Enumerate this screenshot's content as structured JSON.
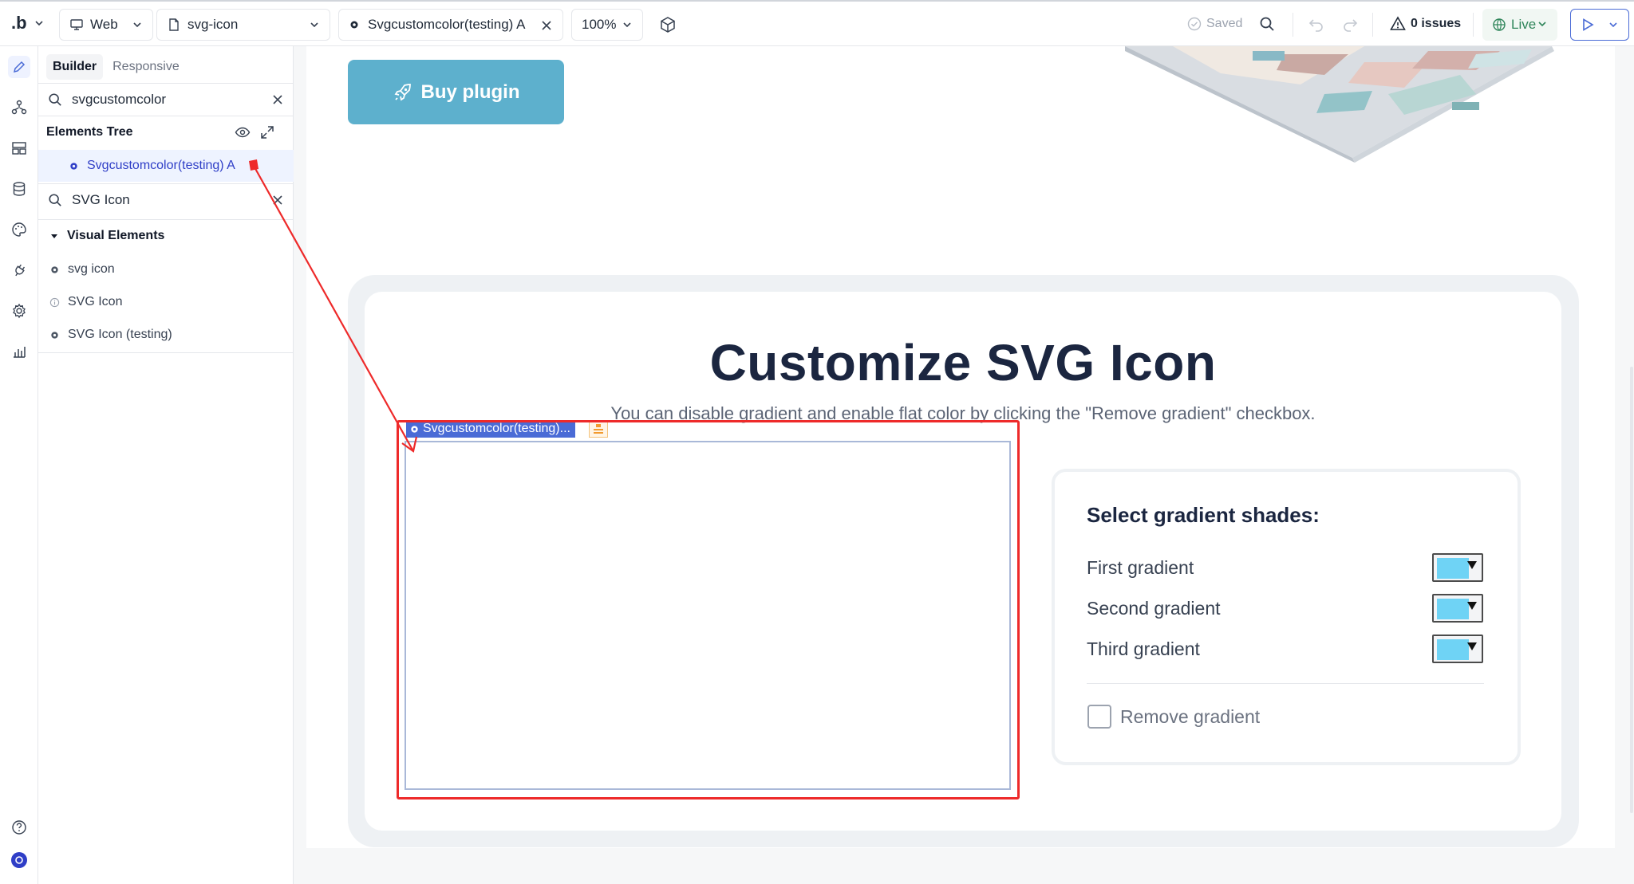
{
  "topbar": {
    "logo": ".b",
    "platform": "Web",
    "page": "svg-icon",
    "element_tab": "Svgcustomcolor(testing) A",
    "zoom": "100%",
    "saved": "Saved",
    "issues": "0 issues",
    "live": "Live"
  },
  "panel": {
    "tabs": [
      "Builder",
      "Responsive"
    ],
    "search_value": "svgcustomcolor",
    "tree_title": "Elements Tree",
    "tree_item": "Svgcustomcolor(testing) A",
    "search2_value": "SVG Icon",
    "section_title": "Visual Elements",
    "results": [
      "svg icon",
      "SVG Icon",
      "SVG Icon (testing)"
    ]
  },
  "canvas": {
    "buy_button": "Buy plugin",
    "heading": "Customize SVG Icon",
    "subtext": "You can disable gradient and enable flat color by clicking the \"Remove gradient\" checkbox.",
    "element_label": "Svgcustomcolor(testing)...",
    "gradient_title": "Select gradient shades:",
    "gradients": [
      {
        "label": "First gradient",
        "color": "#6fd3f5"
      },
      {
        "label": "Second gradient",
        "color": "#6fd3f5"
      },
      {
        "label": "Third gradient",
        "color": "#6fd3f5"
      }
    ],
    "remove_gradient": "Remove gradient"
  },
  "colors": {
    "accent": "#4a6bd6",
    "buy_button": "#5db0cd",
    "annotation": "#ee2a2a",
    "heading": "#1b2640"
  }
}
